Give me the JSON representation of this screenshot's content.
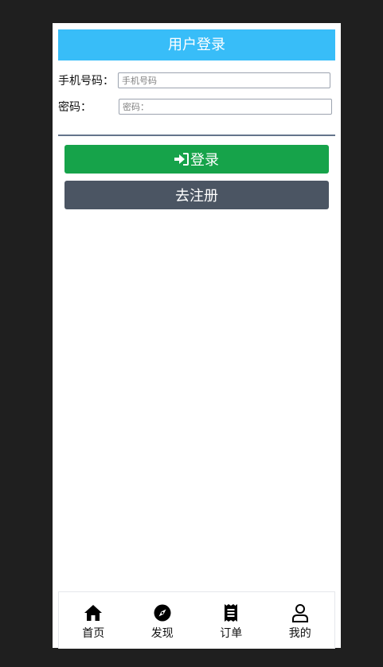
{
  "header": {
    "title": "用户登录"
  },
  "form": {
    "phone_label": "手机号码：",
    "phone_placeholder": "手机号码",
    "password_label": "密码：",
    "password_placeholder": "密码："
  },
  "buttons": {
    "login_label": "登录",
    "register_label": "去注册"
  },
  "tabbar": {
    "items": [
      {
        "label": "首页",
        "icon": "home-icon"
      },
      {
        "label": "发现",
        "icon": "compass-icon"
      },
      {
        "label": "订单",
        "icon": "receipt-icon"
      },
      {
        "label": "我的",
        "icon": "user-icon"
      }
    ]
  },
  "colors": {
    "header": "#38bdf8",
    "login_button": "#16a34a",
    "register_button": "#4b5563",
    "page_background": "#1f1f1f"
  }
}
